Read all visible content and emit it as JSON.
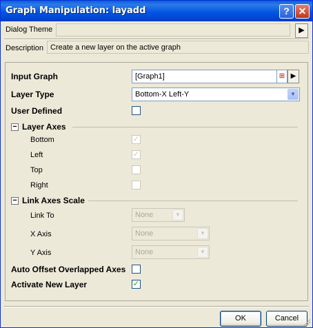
{
  "window": {
    "title": "Graph Manipulation: layadd",
    "help": "?",
    "close": "✕"
  },
  "theme": {
    "label": "Dialog Theme",
    "value": "",
    "arrow": "▶"
  },
  "description": {
    "label": "Description",
    "text": "Create a new layer on the active graph"
  },
  "form": {
    "input_graph": {
      "label": "Input Graph",
      "value": "[Graph1]",
      "arrow": "▶"
    },
    "layer_type": {
      "label": "Layer Type",
      "value": "Bottom-X Left-Y"
    },
    "user_defined": {
      "label": "User Defined",
      "checked": false
    },
    "layer_axes": {
      "label": "Layer Axes",
      "toggle": "−",
      "items": [
        {
          "label": "Bottom",
          "checked": true
        },
        {
          "label": "Left",
          "checked": true
        },
        {
          "label": "Top",
          "checked": false
        },
        {
          "label": "Right",
          "checked": false
        }
      ]
    },
    "link_axes_scale": {
      "label": "Link Axes Scale",
      "toggle": "−",
      "link_to": {
        "label": "Link To",
        "value": "None"
      },
      "x_axis": {
        "label": "X Axis",
        "value": "None"
      },
      "y_axis": {
        "label": "Y Axis",
        "value": "None"
      }
    },
    "auto_offset": {
      "label": "Auto Offset Overlapped Axes",
      "checked": false
    },
    "activate_new_layer": {
      "label": "Activate New Layer",
      "checked": true
    }
  },
  "buttons": {
    "ok": "OK",
    "cancel": "Cancel"
  },
  "icons": {
    "check": "✓",
    "dropdown": "▼"
  }
}
